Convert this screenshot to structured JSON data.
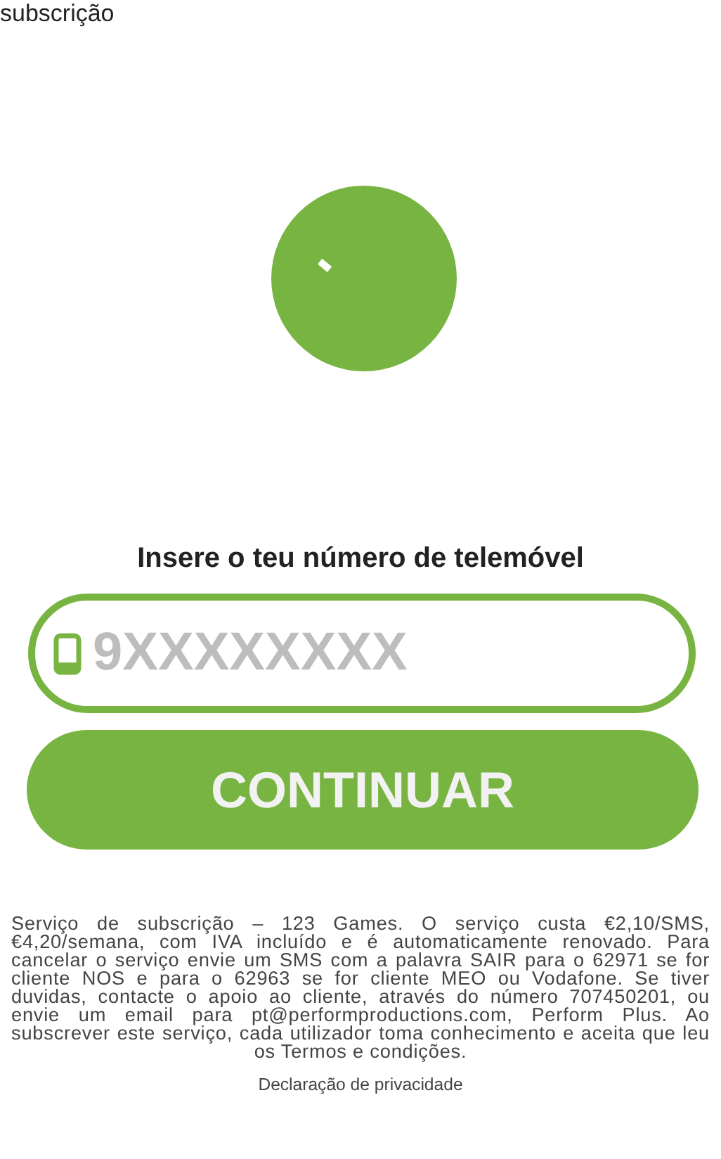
{
  "page_title": "subscrição",
  "prompt": "Insere o teu número de telemóvel",
  "phone_field": {
    "placeholder": "9XXXXXXXX"
  },
  "continue_button": "CONTINUAR",
  "terms": "Serviço de subscrição – 123 Games. O serviço custa €2,10/SMS, €4,20/semana, com IVA incluído e é automaticamente renovado. Para cancelar o serviço envie um SMS com a palavra SAIR para o 62971 se for cliente NOS e para o 62963 se for cliente MEO ou Vodafone. Se tiver duvidas, contacte o apoio ao cliente, através do número 707450201, ou envie um email para pt@performproductions.com, Perform Plus. Ao subscrever este serviço, cada utilizador toma conhecimento e aceita que leu os Termos e condições.",
  "privacy_link": "Declaração de privacidade"
}
